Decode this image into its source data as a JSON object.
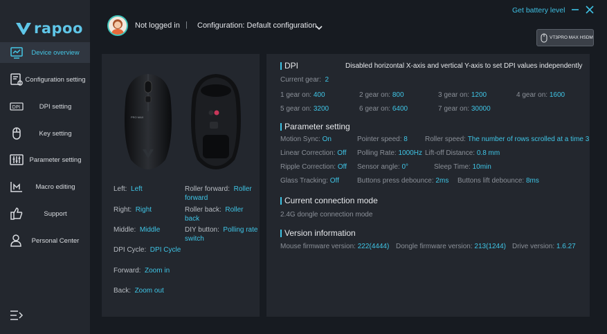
{
  "brand": {
    "logo_text": "rapoo"
  },
  "sidebar": {
    "items": [
      {
        "label": "Device overview",
        "icon": "device-overview-icon",
        "active": true
      },
      {
        "label": "Configuration setting",
        "icon": "configuration-icon"
      },
      {
        "label": "DPI setting",
        "icon": "dpi-icon"
      },
      {
        "label": "Key setting",
        "icon": "mouse-icon"
      },
      {
        "label": "Parameter setting",
        "icon": "sliders-icon"
      },
      {
        "label": "Macro editing",
        "icon": "macro-icon"
      },
      {
        "label": "Support",
        "icon": "thumbs-up-icon"
      },
      {
        "label": "Personal Center",
        "icon": "user-icon"
      }
    ]
  },
  "header": {
    "login_status": "Not logged in",
    "separator": "|",
    "configuration": "Configuration: Default configuration",
    "battery_link": "Get battery level",
    "device_name": "VT3PRO MAX HSDM"
  },
  "mouse": {
    "brand_print": "PRO MAX"
  },
  "buttons": {
    "left": {
      "key": "Left:",
      "value": "Left"
    },
    "right": {
      "key": "Right:",
      "value": "Right"
    },
    "middle": {
      "key": "Middle:",
      "value": "Middle"
    },
    "dpi_cycle": {
      "key": "DPI Cycle:",
      "value": "DPI Cycle"
    },
    "forward": {
      "key": "Forward:",
      "value": "Zoom in"
    },
    "back": {
      "key": "Back:",
      "value": "Zoom out"
    },
    "roller_forward": {
      "key": "Roller forward:",
      "value": "Roller forward"
    },
    "roller_back": {
      "key": "Roller back:",
      "value": "Roller back"
    },
    "diy": {
      "key": "DIY button:",
      "value": "Polling rate switch"
    }
  },
  "dpi": {
    "title": "DPI",
    "description": "Disabled horizontal X-axis and vertical Y-axis to set DPI values independently",
    "current_gear_label": "Current gear:",
    "current_gear": "2",
    "gears": [
      {
        "label": "1 gear on:",
        "value": "400"
      },
      {
        "label": "2 gear on:",
        "value": "800"
      },
      {
        "label": "3 gear on:",
        "value": "1200"
      },
      {
        "label": "4 gear on:",
        "value": "1600"
      },
      {
        "label": "5 gear on:",
        "value": "3200"
      },
      {
        "label": "6 gear on:",
        "value": "6400"
      },
      {
        "label": "7 gear on:",
        "value": "30000"
      }
    ]
  },
  "parameters": {
    "title": "Parameter setting",
    "items": [
      {
        "label": "Motion Sync:",
        "value": "On"
      },
      {
        "label": "Pointer speed:",
        "value": "8"
      },
      {
        "label": "Roller speed:",
        "value": "The number of rows scrolled at a time 3"
      },
      {
        "label": "Linear Correction:",
        "value": "Off"
      },
      {
        "label": "Polling Rate:",
        "value": "1000Hz"
      },
      {
        "label": "Lift-off Distance:",
        "value": "0.8 mm"
      },
      {
        "label": "Ripple Correction:",
        "value": "Off"
      },
      {
        "label": "Sensor angle:",
        "value": "0°"
      },
      {
        "label": "Sleep Time:",
        "value": "10min"
      },
      {
        "label": "Glass Tracking:",
        "value": "Off"
      },
      {
        "label": "Buttons press debounce:",
        "value": "2ms"
      },
      {
        "label": "Buttons lift debounce:",
        "value": "8ms"
      }
    ]
  },
  "connection": {
    "title": "Current connection mode",
    "mode": "2.4G dongle connection mode"
  },
  "version": {
    "title": "Version information",
    "items": [
      {
        "label": "Mouse firmware version:",
        "value": "222(4444)"
      },
      {
        "label": "Dongle firmware version:",
        "value": "213(1244)"
      },
      {
        "label": "Drive version:",
        "value": "1.6.27"
      }
    ]
  },
  "colors": {
    "accent": "#3fc5e6",
    "background": "#171b21",
    "panel": "#23272e",
    "sidebar": "#23272e"
  }
}
